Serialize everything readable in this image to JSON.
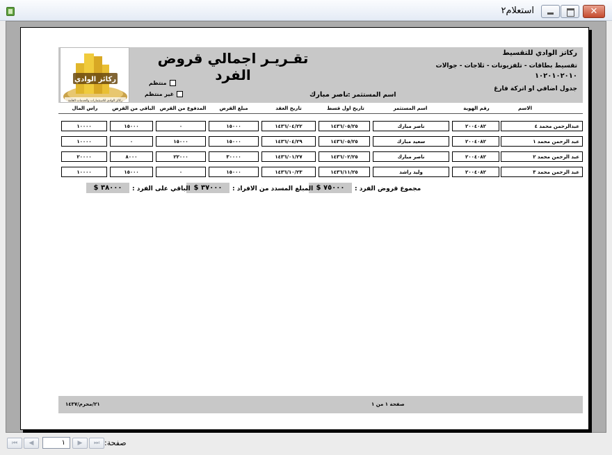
{
  "window": {
    "title": "استعلام٢"
  },
  "report": {
    "title": "تقـريـر اجمالي قروض الفرد",
    "company_name": "ركاتز الوادي للتقسيط",
    "company_services": "تقسيط بطاقات - تلفزيونات - ثلاجات - جوالات",
    "company_number": "١٠٢٠١٠٢٠١٠",
    "company_note": "جدول اضافي او اتركة فارغ",
    "logo_text": "ركائز الوادي",
    "logo_subtext": "ركائز الوادي للاستثمارات والخدمات العامة",
    "checkbox_regular": "منتظم",
    "checkbox_irregular": "غير منتظم",
    "investor_label": "اسم المستثمر :",
    "investor_value": "ناصر مبارك"
  },
  "table": {
    "headers": {
      "name": "الاسم",
      "id_number": "رقم الهوية",
      "investor": "اسم المستثمر",
      "first_installment": "تاريخ اول قسط",
      "contract_date": "تاريخ العقد",
      "loan_amount": "مبلغ القرض",
      "paid": "المدفوع من القرض",
      "remaining": "الباقي من القرض",
      "capital": "راس المال"
    },
    "rows": [
      {
        "name": "عبدالرحمن محمد ٤",
        "id_number": "٢٠٠٤٠٨٢",
        "investor": "ناصر مبارك",
        "first_installment": "١٤٣٦/٠٥/٢٥",
        "contract_date": "١٤٣٦/٠٤/٢٢",
        "loan_amount": "١٥٠٠٠",
        "paid": "٠",
        "remaining": "١٥٠٠٠",
        "capital": "١٠٠٠٠"
      },
      {
        "name": "عبد الرحمن محمد ١",
        "id_number": "٢٠٠٤٠٨٢",
        "investor": "سعيد مبارك",
        "first_installment": "١٤٣٦/٠٥/٢٥",
        "contract_date": "١٤٣٦/٠٤/٢٩",
        "loan_amount": "١٥٠٠٠",
        "paid": "١٥٠٠٠",
        "remaining": "٠",
        "capital": "١٠٠٠٠"
      },
      {
        "name": "عبد الرحمن محمد ٢",
        "id_number": "٢٠٠٤٠٨٢",
        "investor": "ناصر مبارك",
        "first_installment": "١٤٣٦/٠٢/٢٥",
        "contract_date": "١٤٣٦/٠١/٢٧",
        "loan_amount": "٣٠٠٠٠",
        "paid": "٢٢٠٠٠",
        "remaining": "٨٠٠٠",
        "capital": "٢٠٠٠٠"
      },
      {
        "name": "عبد الرحمن محمد ٣",
        "id_number": "٢٠٠٤٠٨٢",
        "investor": "وليد راشد",
        "first_installment": "١٤٣٦/١١/٢٥",
        "contract_date": "١٤٣٦/١٠/٢٣",
        "loan_amount": "١٥٠٠٠",
        "paid": "٠",
        "remaining": "١٥٠٠٠",
        "capital": "١٠٠٠٠"
      }
    ]
  },
  "summary": {
    "total_loans_label": "مجموع قروض الفرد :",
    "total_loans_value": "٧٥٠٠٠ $",
    "paid_label": "المبلغ المسدد من الافراد :",
    "paid_value": "٣٧٠٠٠ $",
    "remaining_label": "الباقي على الفرد :",
    "remaining_value": "٣٨٠٠٠ $"
  },
  "footer": {
    "date": "٢١/محرم/١٤٣٧",
    "page_info": "صفحة ١ من ١"
  },
  "navigation": {
    "page_label": "صفحة:",
    "current_page": "١",
    "first": "⏮",
    "prev": "◀",
    "next": "▶",
    "last": "⏭"
  }
}
